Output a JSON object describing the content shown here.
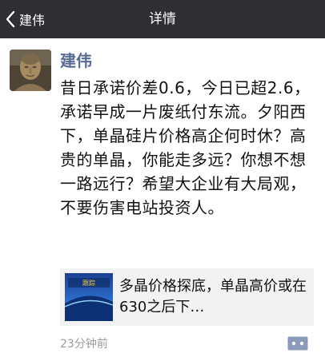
{
  "navbar": {
    "back_label": "建伟",
    "title": "详情",
    "background": "#2e2e33"
  },
  "post": {
    "author": "建伟",
    "author_color": "#576b95",
    "text": "昔日承诺价差0.6，今日已超2.6，承诺早成一片废纸付东流。夕阳西下，单晶硅片价格高企何时休？高贵的单晶，你能走多远？你想不想一路远行？希望大企业有大局观，不要伤害电站投资人。",
    "link": {
      "title": "多晶价格探底，单晶高价或在630之后下…",
      "thumb_caption": "跟踪"
    },
    "time": "23分钟前"
  },
  "icons": {
    "back": "chevron-left-icon",
    "avatar": "buddha-statue-avatar",
    "comment": "comment-dots-icon"
  }
}
